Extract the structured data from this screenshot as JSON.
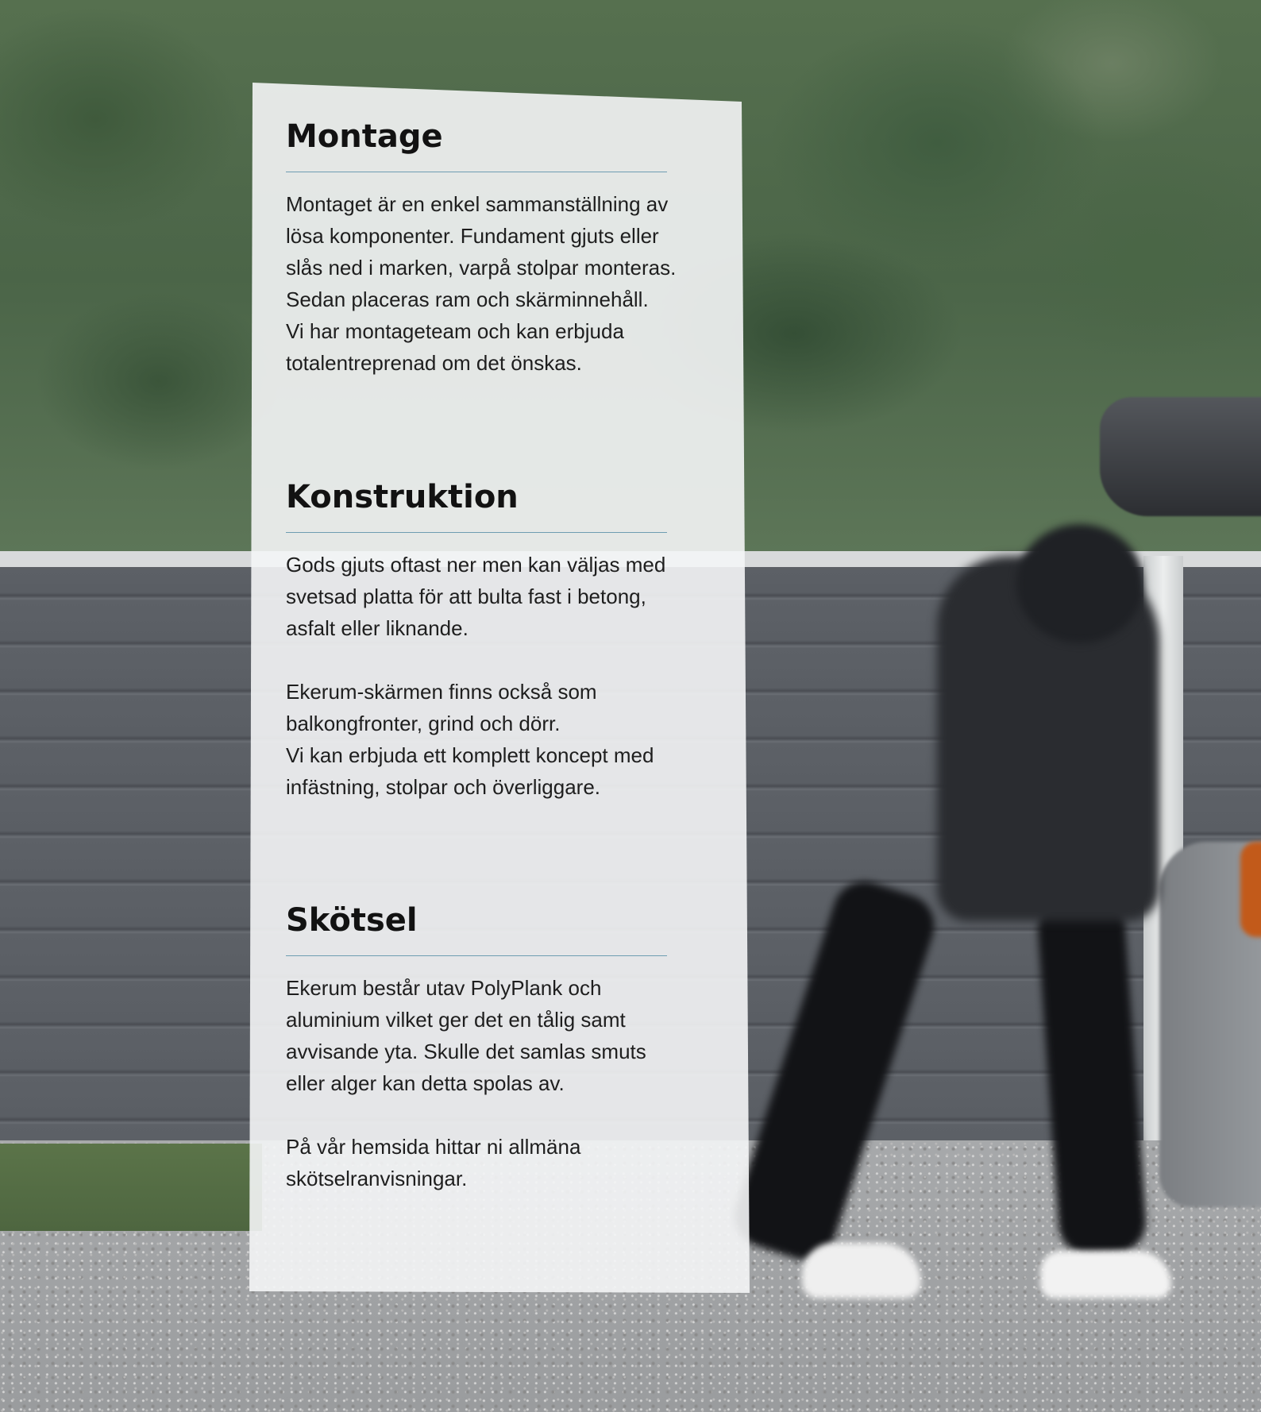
{
  "sections": [
    {
      "heading": "Montage",
      "paragraphs": [
        "Montaget är en enkel sammanställning av\nlösa komponenter. Fundament gjuts eller\nslås ned i marken, varpå stolpar monteras.\nSedan placeras ram och skärminnehåll.\nVi har montageteam och kan erbjuda\ntotalentreprenad om det önskas."
      ]
    },
    {
      "heading": "Konstruktion",
      "paragraphs": [
        "Gods gjuts oftast ner men kan väljas med\nsvetsad platta för att bulta fast i betong,\nasfalt eller liknande.",
        "Ekerum-skärmen finns också som\nbalkongfronter, grind och dörr.\nVi kan erbjuda ett komplett koncept med\ninfästning, stolpar och överliggare."
      ]
    },
    {
      "heading": "Skötsel",
      "paragraphs": [
        "Ekerum består utav PolyPlank och\naluminium vilket ger det en tålig samt\navvisande yta. Skulle det samlas smuts\neller alger kan detta spolas av.",
        "På vår hemsida hittar ni allmäna\nskötselranvisningar."
      ]
    }
  ],
  "colors": {
    "rule": "#6e9db2",
    "panel": "#f4f5f6",
    "text": "#1e1e1e"
  }
}
